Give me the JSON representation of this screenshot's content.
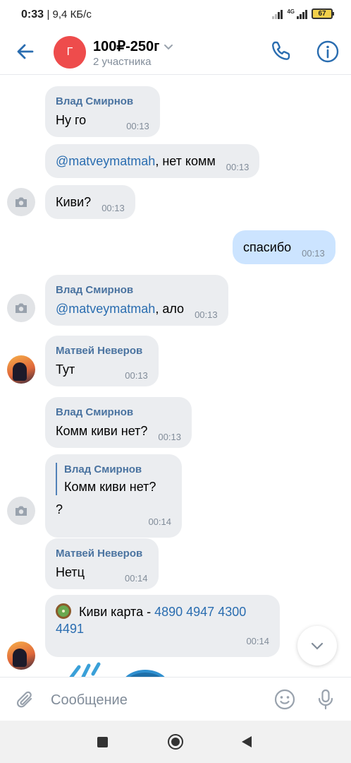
{
  "status_bar": {
    "time": "0:33",
    "speed": "| 9,4 КБ/с",
    "network": "4G",
    "battery": "67"
  },
  "header": {
    "avatar_letter": "Г",
    "title": "100₽-250г",
    "subtitle": "2 участника"
  },
  "messages": [
    {
      "sender": "Влад Смирнов",
      "text": "Ну го",
      "time": "00:13"
    },
    {
      "mention": "@matveymatmah",
      "text": ",  нет комм",
      "time": "00:13"
    },
    {
      "text": "Киви?",
      "time": "00:13"
    },
    {
      "text": "спасибо",
      "time": "00:13"
    },
    {
      "sender": "Влад Смирнов",
      "mention": "@matveymatmah",
      "text": ",  ало",
      "time": "00:13"
    },
    {
      "sender": "Матвей Неверов",
      "text": "Тут",
      "time": "00:13"
    },
    {
      "sender": "Влад Смирнов",
      "text": "Комм киви нет?",
      "time": "00:13"
    },
    {
      "reply_sender": "Влад Смирнов",
      "reply_text": "Комм киви нет?",
      "text": "?",
      "time": "00:14"
    },
    {
      "sender": "Матвей Неверов",
      "text": "Нетц",
      "time": "00:14"
    },
    {
      "text": " Киви карта - ",
      "card": "4890 4947 4300 4491",
      "time": "00:14"
    }
  ],
  "input": {
    "placeholder": "Сообщение"
  },
  "colors": {
    "accent": "#2a6db0",
    "incoming": "#ebedf0",
    "outgoing": "#cce4ff",
    "group_avatar": "#ee4c4c"
  }
}
